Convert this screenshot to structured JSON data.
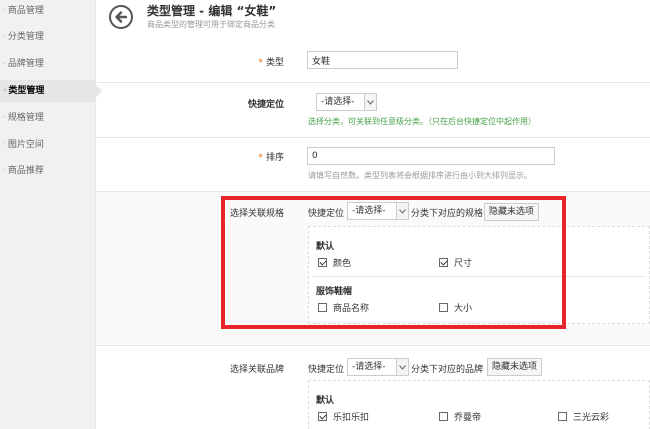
{
  "sidebar": {
    "items": [
      {
        "label": "商品管理",
        "active": false
      },
      {
        "label": "分类管理",
        "active": false
      },
      {
        "label": "品牌管理",
        "active": false
      },
      {
        "label": "类型管理",
        "active": true
      },
      {
        "label": "规格管理",
        "active": false
      },
      {
        "label": "图片空间",
        "active": false
      },
      {
        "label": "商品推荐",
        "active": false
      }
    ]
  },
  "header": {
    "title": "类型管理 - 编辑 “女鞋”",
    "subtitle": "商品类型的管理可用于绑定商品分类"
  },
  "form": {
    "type": {
      "required_mark": "*",
      "label": "类型",
      "value": "女鞋"
    },
    "quick_locate": {
      "label": "快捷定位",
      "select_value": "-请选择-",
      "hint": "选择分类，可关联到任意级分类。（只在后台快捷定位中起作用）"
    },
    "sort": {
      "required_mark": "*",
      "label": "排序",
      "value": "0",
      "hint": "请填写自然数。类型列表将会根据排序进行由小到大排列显示。"
    },
    "spec": {
      "label": "选择关联规格",
      "quick_locate": "快捷定位",
      "select_value": "-请选择-",
      "after_text": "分类下对应的规格",
      "hide_button": "隐藏未选项",
      "groups": [
        {
          "title": "默认",
          "items": [
            {
              "label": "颜色",
              "checked": true
            },
            {
              "label": "尺寸",
              "checked": true
            }
          ]
        },
        {
          "title": "服饰鞋帽",
          "items": [
            {
              "label": "商品名称",
              "checked": false
            },
            {
              "label": "大小",
              "checked": false
            }
          ]
        }
      ]
    },
    "brand": {
      "label": "选择关联品牌",
      "quick_locate": "快捷定位",
      "select_value": "-请选择-",
      "after_text": "分类下对应的品牌",
      "hide_button": "隐藏未选项",
      "groups": [
        {
          "title": "默认",
          "items": [
            {
              "label": "乐扣乐扣",
              "checked": true
            },
            {
              "label": "乔曼帝",
              "checked": false
            },
            {
              "label": "三光云彩",
              "checked": false
            }
          ]
        }
      ]
    }
  },
  "colors": {
    "highlight": "#e8242b",
    "hint_green": "#4aa24a",
    "required": "#e36c09"
  }
}
